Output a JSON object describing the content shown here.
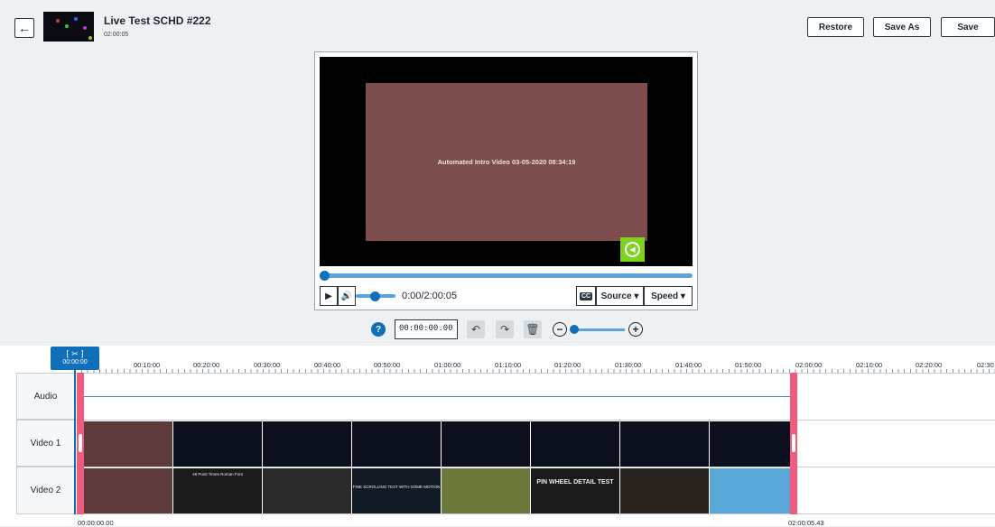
{
  "header": {
    "title": "Live Test SCHD #222",
    "duration": "02:00:05",
    "restore_label": "Restore",
    "save_as_label": "Save As",
    "save_label": "Save"
  },
  "player": {
    "overlay_text": "Automated Intro Video 03-05-2020 08:34:19",
    "timecode": "0:00/2:00:05",
    "cc_label": "CC",
    "source_label": "Source ▾",
    "speed_label": "Speed ▾",
    "progress": 0.0
  },
  "toolbar": {
    "help_label": "?",
    "timecode_value": "00:00:00.00"
  },
  "timeline": {
    "scissor_time": "00:00:00",
    "ruler": [
      "00:10:00",
      "00:20:00",
      "00:30:00",
      "00:40:00",
      "00:50:00",
      "01:00:00",
      "01:10:00",
      "01:20:00",
      "01:30:00",
      "01:40:00",
      "01:50:00",
      "02:00:00",
      "02:10:00",
      "02:20:00",
      "02:30"
    ],
    "tracks": [
      "Audio",
      "Video 1",
      "Video 2"
    ],
    "video2_clips": [
      "",
      "48 Point Times Roman Font",
      "",
      "FINE SCROLLING TEXT WITH SOME MOTION",
      "",
      "PIN WHEEL DETAIL TEST",
      "",
      ""
    ],
    "start_tc": "00:00:00.00",
    "end_tc": "02:00:05.43"
  },
  "colors": {
    "accent": "#0f6fb8",
    "selection": "#f25a7e",
    "badge": "#7ed321"
  }
}
